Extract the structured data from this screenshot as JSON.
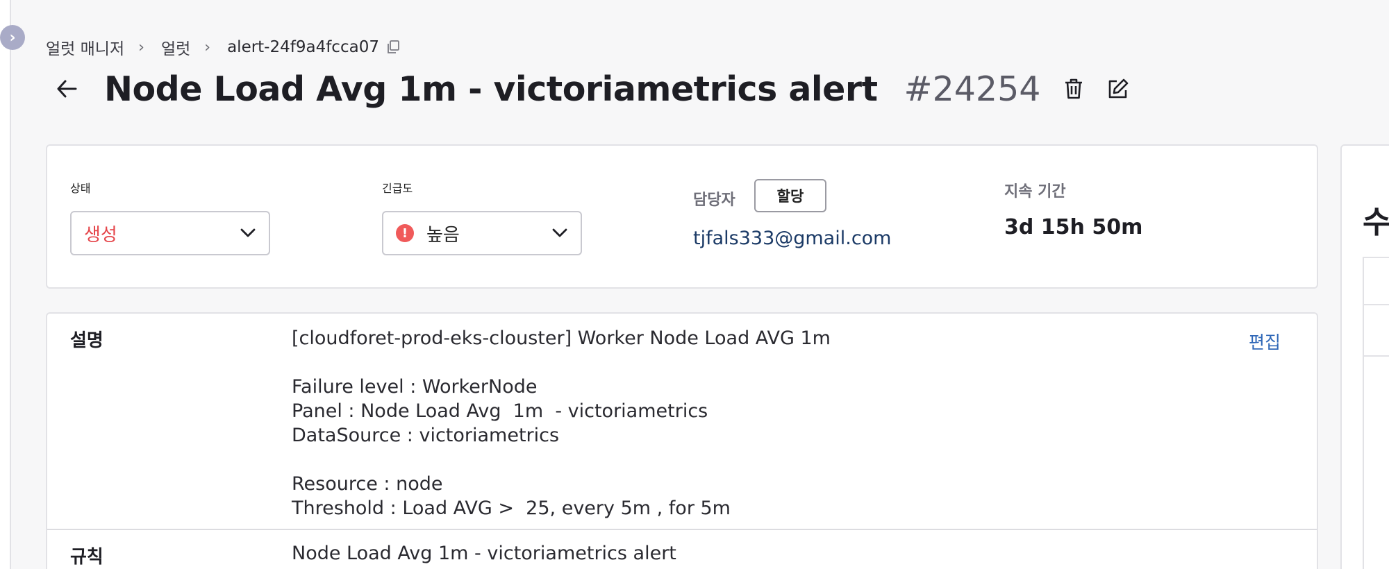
{
  "breadcrumb": {
    "items": [
      "얼럿 매니저",
      "얼럿"
    ],
    "current": "alert-24f9a4fcca07"
  },
  "header": {
    "title": "Node Load Avg 1m - victoriametrics alert",
    "number": "#24254"
  },
  "status_card": {
    "status": {
      "label": "상태",
      "value": "생성",
      "color": "#e5454a"
    },
    "urgency": {
      "label": "긴급도",
      "value": "높음",
      "icon": "alert-circle-icon",
      "color": "#f05a5a"
    },
    "assignee": {
      "label": "담당자",
      "assign_button": "할당",
      "email": "tjfals333@gmail.com"
    },
    "duration": {
      "label": "지속 기간",
      "value": "3d 15h 50m"
    }
  },
  "details": {
    "description": {
      "label": "설명",
      "edit_link": "편집",
      "text": "[cloudforet-prod-eks-clouster] Worker Node Load AVG 1m\n\nFailure level : WorkerNode\nPanel : Node Load Avg  1m  - victoriametrics\nDataSource : victoriametrics\n\nResource : node\nThreshold : Load AVG >  25, every 5m , for 5m"
    },
    "rule": {
      "label": "규칙",
      "value": "Node Load Avg 1m - victoriametrics alert"
    }
  },
  "side_panel": {
    "heading_partial": "수"
  }
}
